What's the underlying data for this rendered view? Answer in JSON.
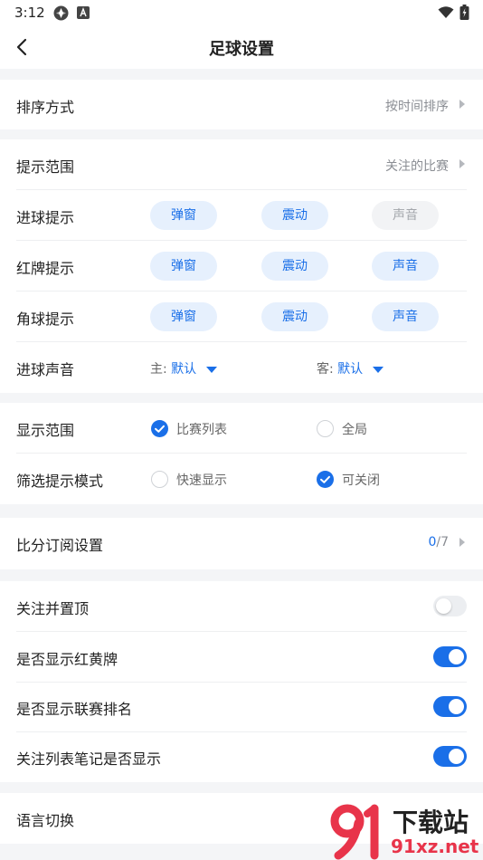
{
  "status_bar": {
    "time": "3:12"
  },
  "header": {
    "title": "足球设置"
  },
  "sort": {
    "label": "排序方式",
    "value": "按时间排序"
  },
  "alerts": {
    "scope": {
      "label": "提示范围",
      "value": "关注的比赛"
    },
    "goal": {
      "label": "进球提示",
      "options": [
        "弹窗",
        "震动",
        "声音"
      ],
      "enabled": [
        true,
        true,
        false
      ]
    },
    "red_card": {
      "label": "红牌提示",
      "options": [
        "弹窗",
        "震动",
        "声音"
      ],
      "enabled": [
        true,
        true,
        true
      ]
    },
    "corner": {
      "label": "角球提示",
      "options": [
        "弹窗",
        "震动",
        "声音"
      ],
      "enabled": [
        true,
        true,
        true
      ]
    },
    "goal_sound": {
      "label": "进球声音",
      "home_prefix": "主:",
      "home_value": "默认",
      "away_prefix": "客:",
      "away_value": "默认"
    }
  },
  "display": {
    "range": {
      "label": "显示范围",
      "options": [
        "比赛列表",
        "全局"
      ],
      "selected": "比赛列表"
    },
    "filter_mode": {
      "label": "筛选提示模式",
      "options": [
        "快速显示",
        "可关闭"
      ],
      "selected": "可关闭"
    }
  },
  "score_subscription": {
    "label": "比分订阅设置",
    "current": "0",
    "total": "/7"
  },
  "toggles": [
    {
      "label": "关注并置顶",
      "on": false
    },
    {
      "label": "是否显示红黄牌",
      "on": true
    },
    {
      "label": "是否显示联赛排名",
      "on": true
    },
    {
      "label": "关注列表笔记是否显示",
      "on": true
    }
  ],
  "language": {
    "label": "语言切换"
  },
  "watermark": {
    "brand": "下载站",
    "domain": "91xz.net"
  },
  "colors": {
    "accent": "#1a6fe8",
    "pill_on_bg": "#e6f0fd",
    "watermark_red": "#e8344a"
  }
}
